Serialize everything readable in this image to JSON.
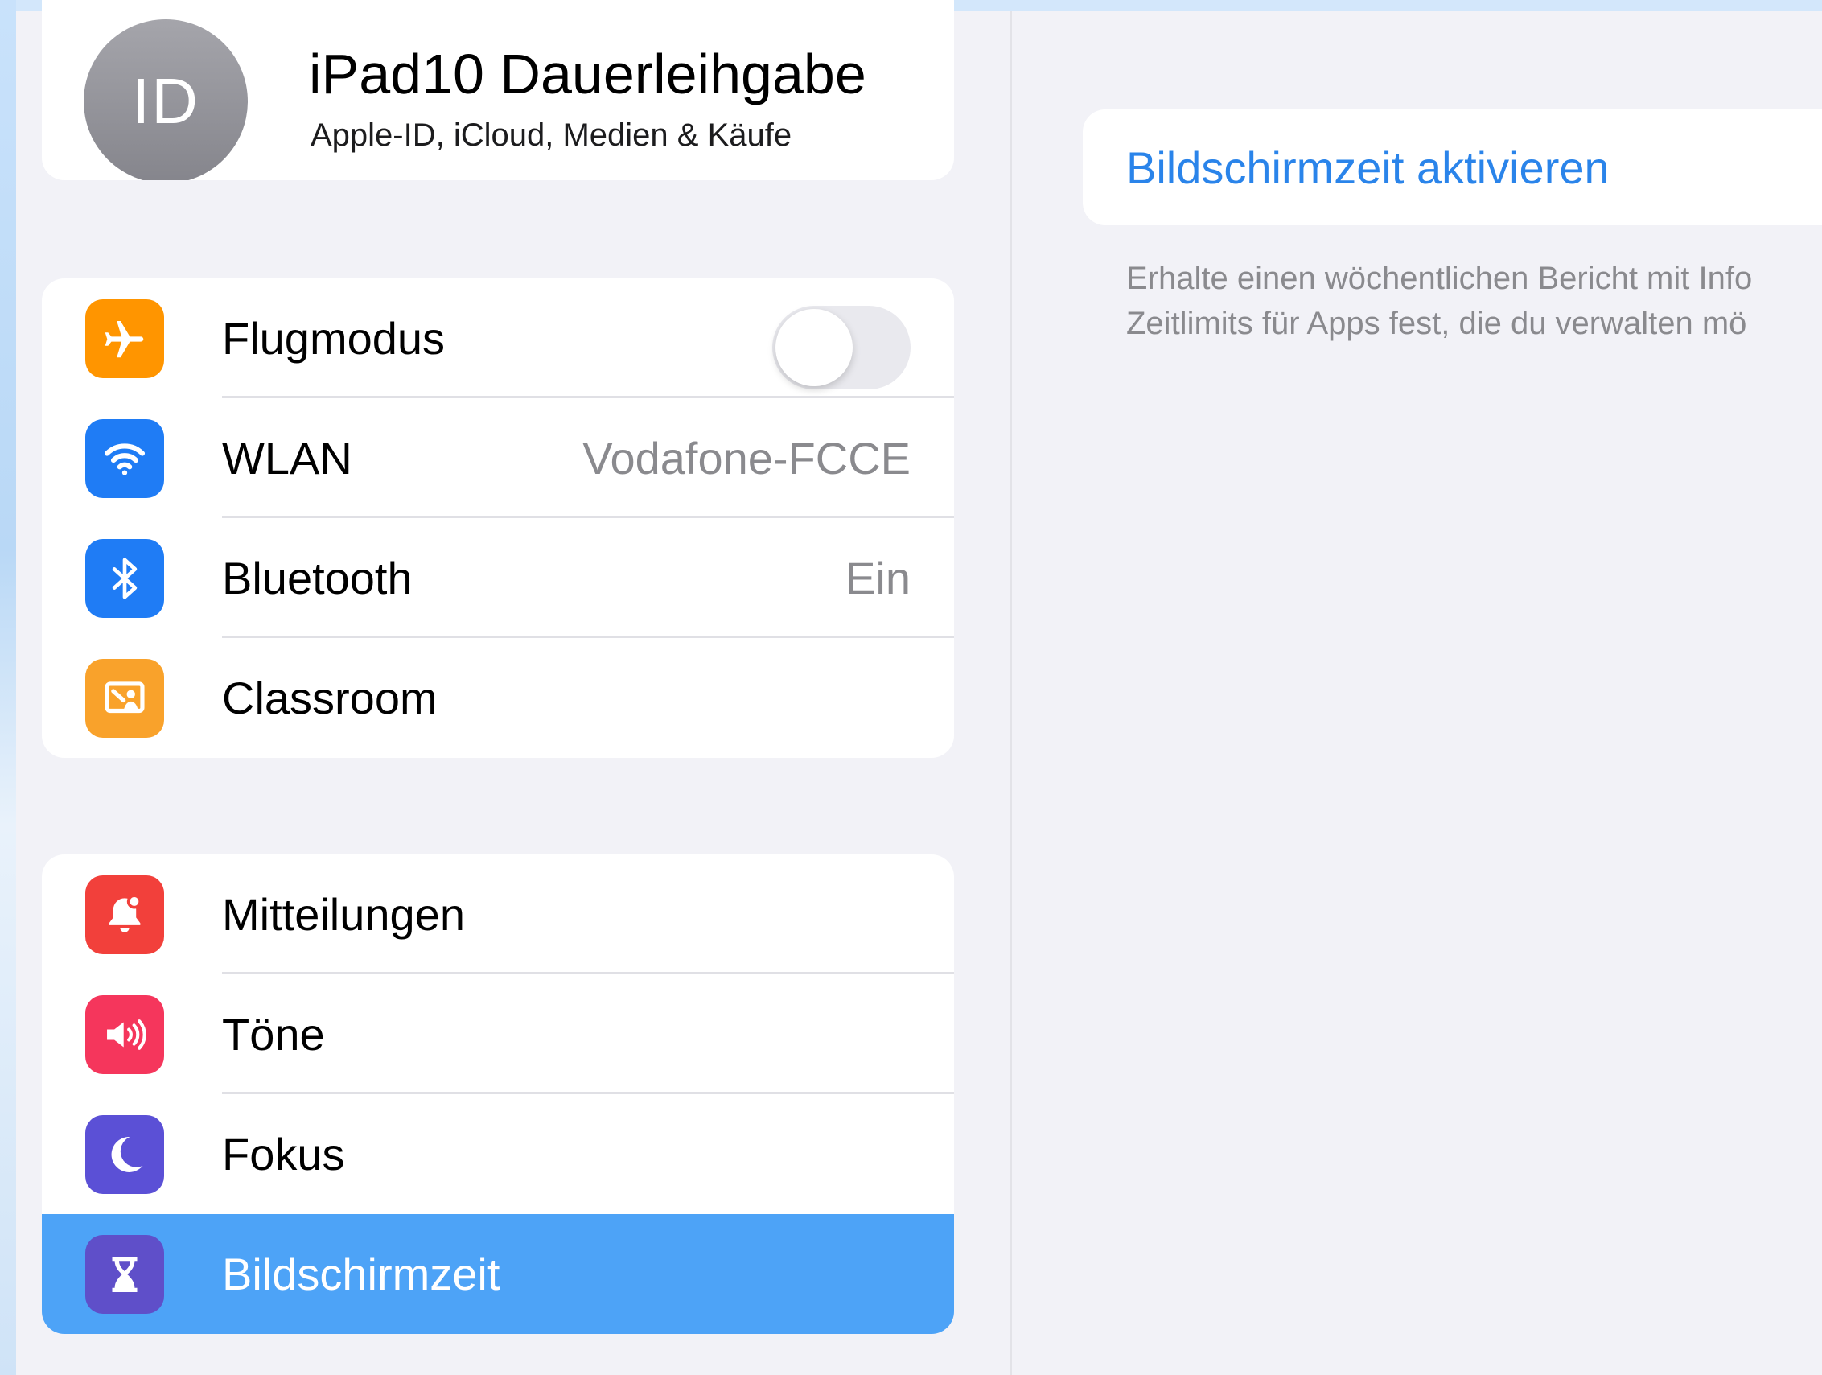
{
  "profile": {
    "initials": "ID",
    "name": "iPad10 Dauerleihgabe",
    "subtitle": "Apple-ID, iCloud, Medien & Käufe"
  },
  "group1": [
    {
      "label": "Flugmodus",
      "icon": "airplane-icon",
      "toggle_on": false
    },
    {
      "label": "WLAN",
      "icon": "wifi-icon",
      "value": "Vodafone-FCCE"
    },
    {
      "label": "Bluetooth",
      "icon": "bluetooth-icon",
      "value": "Ein"
    },
    {
      "label": "Classroom",
      "icon": "classroom-icon"
    }
  ],
  "group2": [
    {
      "label": "Mitteilungen",
      "icon": "notifications-icon"
    },
    {
      "label": "Töne",
      "icon": "sound-icon"
    },
    {
      "label": "Fokus",
      "icon": "moon-icon"
    },
    {
      "label": "Bildschirmzeit",
      "icon": "hourglass-icon",
      "selected": true
    }
  ],
  "detail": {
    "activate_label": "Bildschirmzeit aktivieren",
    "footer_line1": "Erhalte einen wöchentlichen Bericht mit Info",
    "footer_line2": "Zeitlimits für Apps fest, die du verwalten mö"
  },
  "colors": {
    "selection": "#4da3f7",
    "link": "#2a84ea",
    "airplane": "#ff9500",
    "wifi": "#1f7cf5",
    "bluetooth": "#1f7cf5",
    "classroom": "#f9a22b",
    "notifications": "#f2403b",
    "sounds": "#f5365c",
    "focus": "#5b50d6",
    "screentime": "#5f4fc9"
  }
}
